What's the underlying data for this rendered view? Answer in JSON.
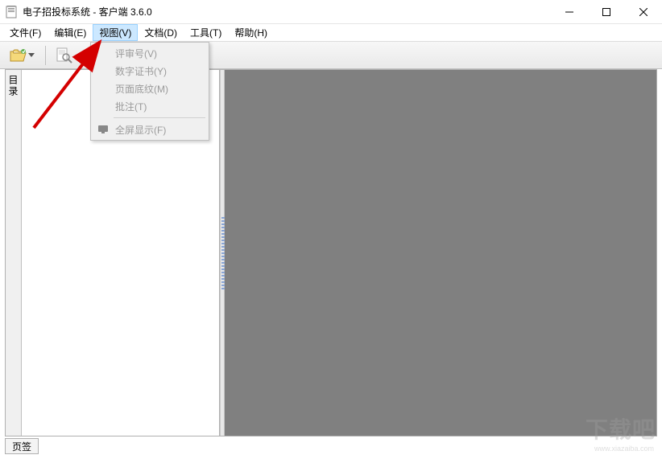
{
  "window": {
    "title": "电子招投标系统 - 客户端 3.6.0"
  },
  "menu": {
    "file": "文件(F)",
    "edit": "编辑(E)",
    "view": "视图(V)",
    "document": "文档(D)",
    "tool": "工具(T)",
    "help": "帮助(H)"
  },
  "view_dropdown": {
    "review": "评审号(V)",
    "cert": "数字证书(Y)",
    "pattern": "页面底纹(M)",
    "annot": "批注(T)",
    "fullscreen": "全屏显示(F)"
  },
  "side_tab": "目录",
  "bottom_tab": "页签",
  "watermark": "下载吧",
  "watermark_sub": "www.xiazaiba.com"
}
